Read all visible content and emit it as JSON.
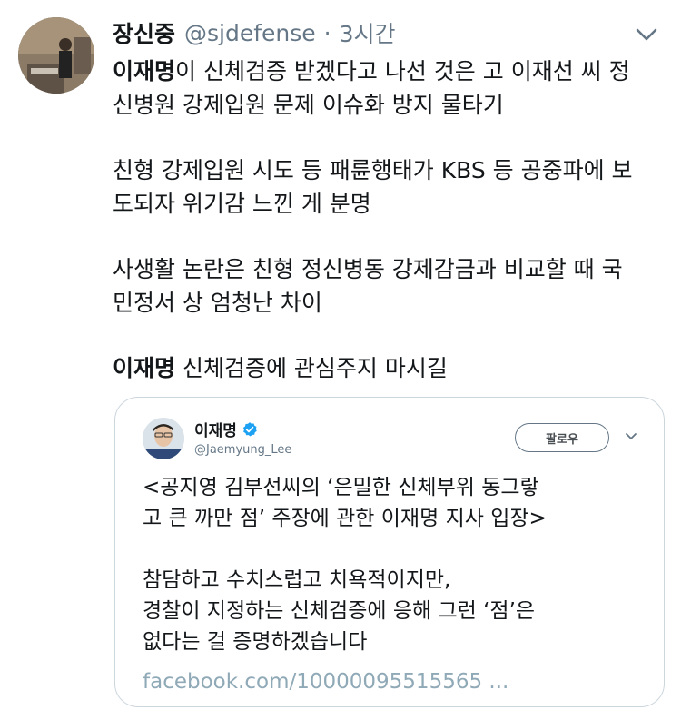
{
  "tweet": {
    "author_name": "장신중",
    "handle": "@sjdefense",
    "separator": "·",
    "time": "3시간",
    "paragraphs": [
      {
        "lines": [
          {
            "bold": "이재명",
            "rest": "이 신체검증 받겠다고 나선 것은 고 이재선 씨 정"
          },
          {
            "bold": "",
            "rest": "신병원 강제입원 문제 이슈화 방지 물타기"
          }
        ]
      },
      {
        "lines": [
          {
            "bold": "",
            "rest": "친형 강제입원 시도 등 패륜행태가 KBS 등 공중파에 보"
          },
          {
            "bold": "",
            "rest": "도되자 위기감 느낀 게 분명"
          }
        ]
      },
      {
        "lines": [
          {
            "bold": "",
            "rest": "사생활 논란은 친형 정신병동 강제감금과 비교할 때 국"
          },
          {
            "bold": "",
            "rest": "민정서 상 엄청난 차이"
          }
        ]
      },
      {
        "lines": [
          {
            "bold": "이재명",
            "rest": " 신체검증에 관심주지 마시길"
          }
        ]
      }
    ]
  },
  "quoted": {
    "name": "이재명",
    "handle": "@Jaemyung_Lee",
    "follow_label": "팔로우",
    "paragraphs": [
      [
        "<공지영 김부선씨의 ‘은밀한 신체부위 동그랗",
        "고 큰 까만 점’ 주장에 관한 이재명 지사 입장>"
      ],
      [
        "참담하고 수치스럽고 치욕적이지만,",
        "경찰이 지정하는 신체검증에 응해 그런 ‘점’은",
        "없다는 걸 증명하겠습니다"
      ]
    ],
    "link": "facebook.com/10000095515565 ..."
  },
  "icons": {
    "caret": "chevron-down-icon",
    "verified": "verified-badge-icon"
  },
  "colors": {
    "text": "#14171a",
    "secondary": "#657786",
    "border": "#ccd6dd",
    "verified": "#1da1f2",
    "link": "#8fa9b7"
  }
}
